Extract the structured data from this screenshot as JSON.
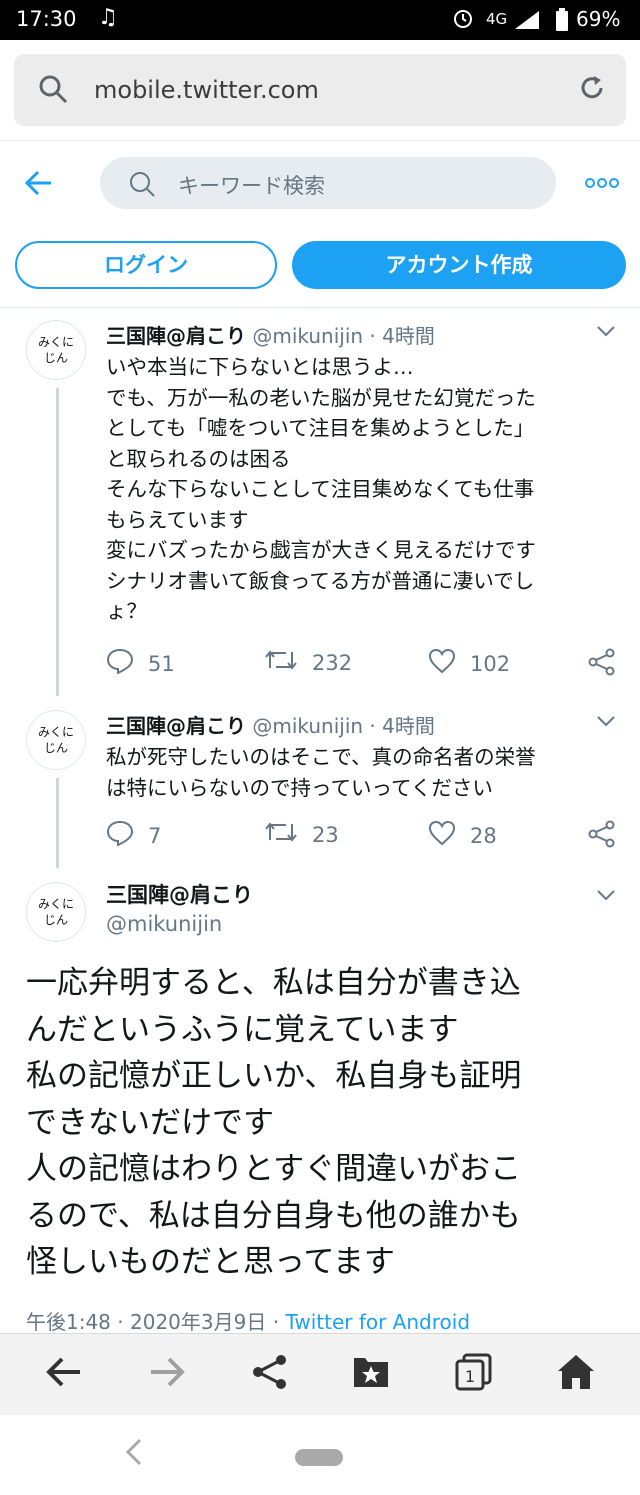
{
  "status_bar": {
    "time": "17:30",
    "network": "4G",
    "battery": "69%"
  },
  "browser": {
    "url": "mobile.twitter.com"
  },
  "twitter_header": {
    "search_placeholder": "キーワード検索",
    "login_label": "ログイン",
    "signup_label": "アカウント作成"
  },
  "colors": {
    "accent": "#1da1f2",
    "muted": "#657786"
  },
  "tweets": [
    {
      "avatar_text": "みくにじん",
      "name": "三国陣@肩こり",
      "handle": "@mikunijin",
      "time": "4時間",
      "text": "いや本当に下らないとは思うよ…\nでも、万が一私の老いた脳が見せた幻覚だった\nとしても「嘘をついて注目を集めようとした」\nと取られるのは困る\nそんな下らないことして注目集めなくても仕事\nもらえています\n変にバズったから戯言が大きく見えるだけです\nシナリオ書いて飯食ってる方が普通に凄いでし\nょ？",
      "replies": "51",
      "retweets": "232",
      "likes": "102"
    },
    {
      "avatar_text": "みくにじん",
      "name": "三国陣@肩こり",
      "handle": "@mikunijin",
      "time": "4時間",
      "text": "私が死守したいのはそこで、真の命名者の栄誉\nは特にいらないので持っていってください",
      "replies": "7",
      "retweets": "23",
      "likes": "28"
    }
  ],
  "main_tweet": {
    "avatar_text": "みくにじん",
    "name": "三国陣@肩こり",
    "handle": "@mikunijin",
    "text": "一応弁明すると、私は自分が書き込\nんだというふうに覚えています\n私の記憶が正しいか、私自身も証明\nできないだけです\n人の記憶はわりとすぐ間違いがおこ\nるので、私は自分自身も他の誰かも\n怪しいものだと思ってます",
    "time": "午後1:48",
    "date": "2020年3月9日",
    "separator": "·",
    "via": "Twitter for Android"
  },
  "icons": [
    "music-note-icon",
    "alarm-icon",
    "signal-icon",
    "battery-icon",
    "search-icon",
    "reload-icon",
    "back-arrow-icon",
    "more-icon",
    "reply-icon",
    "retweet-icon",
    "like-icon",
    "share-icon",
    "chevron-down-icon",
    "forward-arrow-icon",
    "bookmark-star-icon",
    "tabs-icon",
    "home-icon"
  ],
  "bottom_bar": {
    "tab_count": "1"
  }
}
